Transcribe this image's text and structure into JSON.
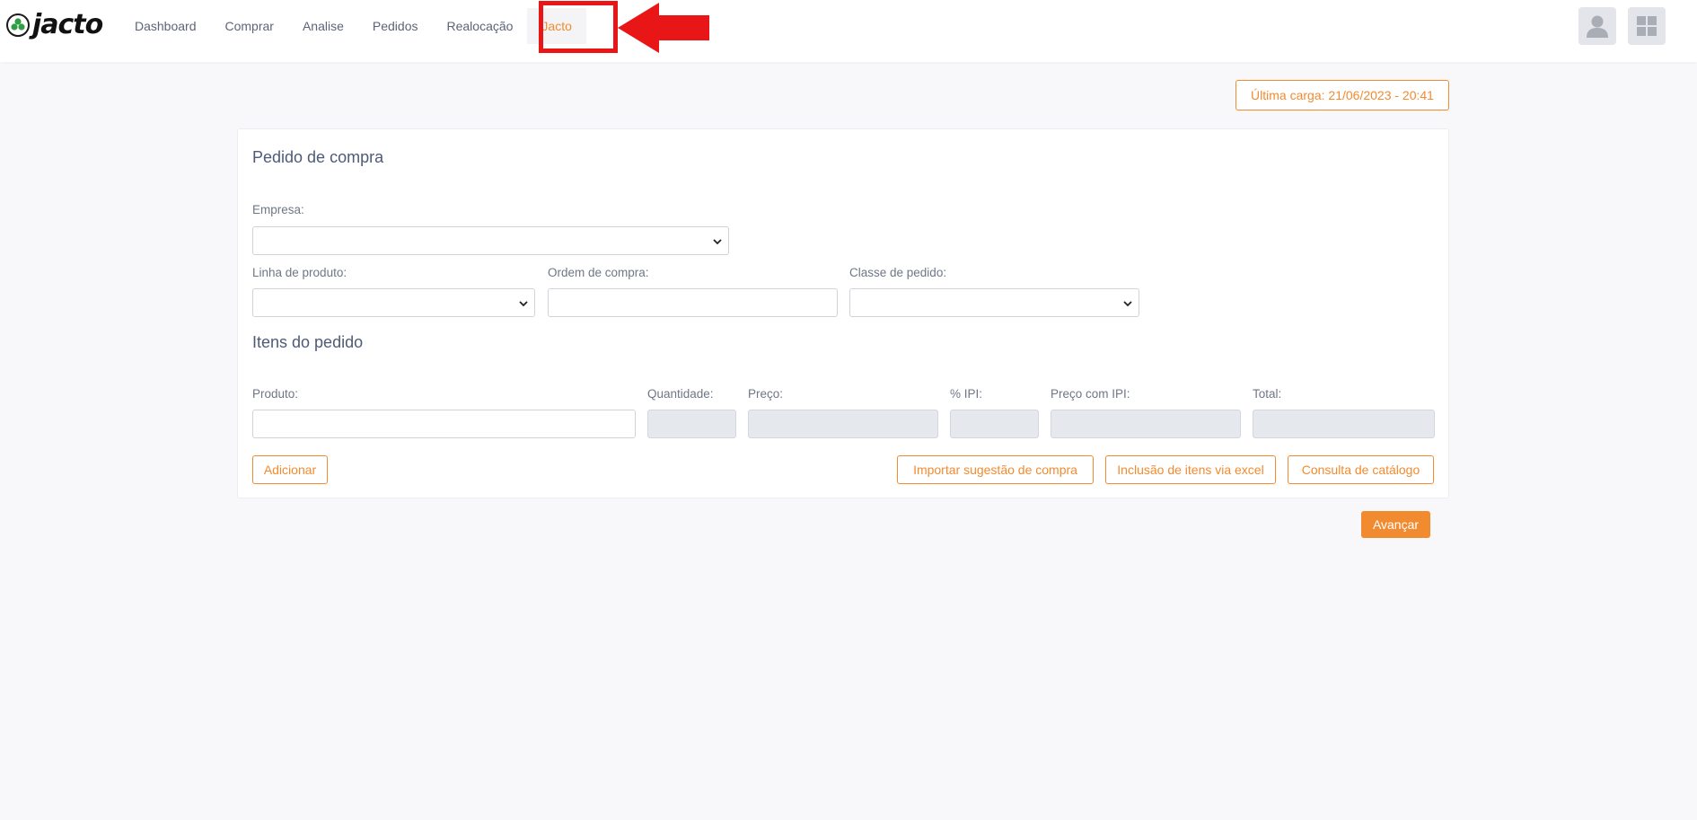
{
  "brand": {
    "name": "jacto"
  },
  "nav": {
    "items": [
      {
        "label": "Dashboard"
      },
      {
        "label": "Comprar"
      },
      {
        "label": "Analise"
      },
      {
        "label": "Pedidos"
      },
      {
        "label": "Realocação"
      },
      {
        "label": "Jacto"
      }
    ],
    "active_index": 5
  },
  "header": {
    "avatar_icon": "user-icon",
    "apps_icon": "grid-icon"
  },
  "last_load": {
    "label": "Última carga: 21/06/2023 - 20:41"
  },
  "form": {
    "title": "Pedido de compra",
    "empresa": {
      "label": "Empresa:",
      "value": ""
    },
    "linha_produto": {
      "label": "Linha de produto:",
      "value": ""
    },
    "ordem_compra": {
      "label": "Ordem de compra:",
      "value": ""
    },
    "classe_pedido": {
      "label": "Classe de pedido:",
      "value": ""
    }
  },
  "items": {
    "title": "Itens do pedido",
    "produto": {
      "label": "Produto:",
      "value": ""
    },
    "quantidade": {
      "label": "Quantidade:",
      "value": ""
    },
    "preco": {
      "label": "Preço:",
      "value": ""
    },
    "ipi": {
      "label": "% IPI:",
      "value": ""
    },
    "preco_ipi": {
      "label": "Preço com IPI:",
      "value": ""
    },
    "total": {
      "label": "Total:",
      "value": ""
    }
  },
  "buttons": {
    "adicionar": "Adicionar",
    "importar": "Importar sugestão de compra",
    "inclusao": "Inclusão de itens via excel",
    "consulta": "Consulta de catálogo",
    "avancar": "Avançar"
  },
  "colors": {
    "accent": "#f28b30",
    "annotation": "#e81616",
    "heading": "#4e5a78"
  }
}
